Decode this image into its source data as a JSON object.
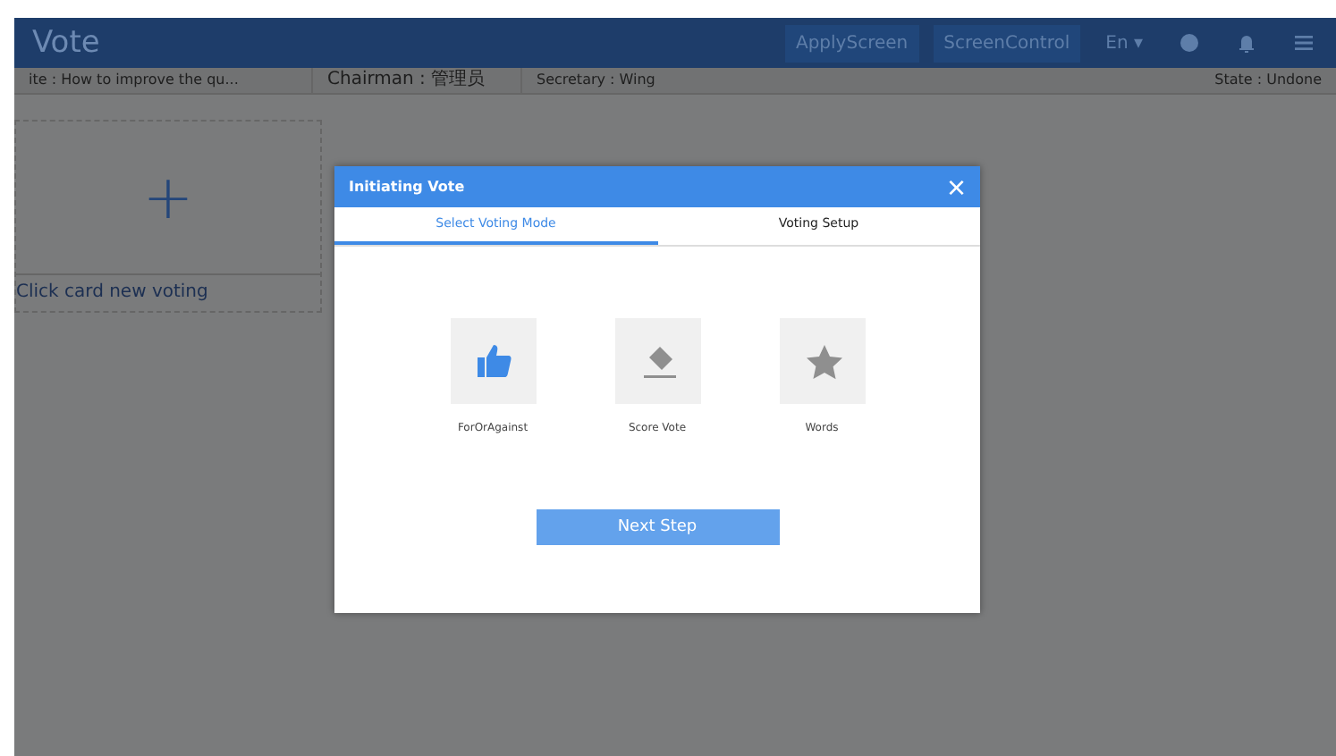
{
  "app": {
    "title": "Vote",
    "header_buttons": [
      "ApplyScreen",
      "ScreenControl"
    ],
    "language": "En ▾"
  },
  "info_bar": {
    "topic": "ite : How to improve the qu...",
    "chairman": "Chairman : 管理员",
    "secretary": "Secretary : Wing",
    "state": "State : Undone"
  },
  "new_card": {
    "icon": "+",
    "label": "Click card new voting"
  },
  "dialog": {
    "title": "Initiating Vote",
    "close": "×",
    "tabs": [
      {
        "label": "Select Voting Mode",
        "selected": true
      },
      {
        "label": "Voting Setup",
        "selected": false
      }
    ],
    "modes": [
      {
        "kind": "thumb",
        "label": "ForOrAgainst",
        "selected": true
      },
      {
        "kind": "eraser",
        "label": "Score Vote",
        "selected": false
      },
      {
        "kind": "star",
        "label": "Words",
        "selected": false
      }
    ],
    "next_button": "Next Step"
  }
}
